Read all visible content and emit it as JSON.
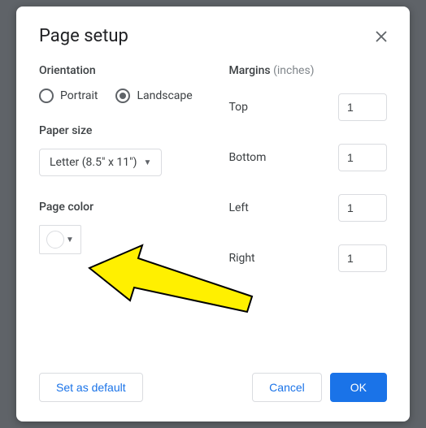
{
  "dialog": {
    "title": "Page setup",
    "orientation": {
      "label": "Orientation",
      "portrait_label": "Portrait",
      "landscape_label": "Landscape",
      "selected": "landscape"
    },
    "paper_size": {
      "label": "Paper size",
      "selected": "Letter (8.5\" x 11\")"
    },
    "page_color": {
      "label": "Page color",
      "value": "#ffffff"
    },
    "margins": {
      "label": "Margins",
      "unit": "(inches)",
      "top": {
        "label": "Top",
        "value": "1"
      },
      "bottom": {
        "label": "Bottom",
        "value": "1"
      },
      "left": {
        "label": "Left",
        "value": "1"
      },
      "right": {
        "label": "Right",
        "value": "1"
      }
    },
    "buttons": {
      "set_default": "Set as default",
      "cancel": "Cancel",
      "ok": "OK"
    }
  },
  "annotation": {
    "arrow_target": "page-color-button",
    "arrow_color": "#fff000"
  }
}
